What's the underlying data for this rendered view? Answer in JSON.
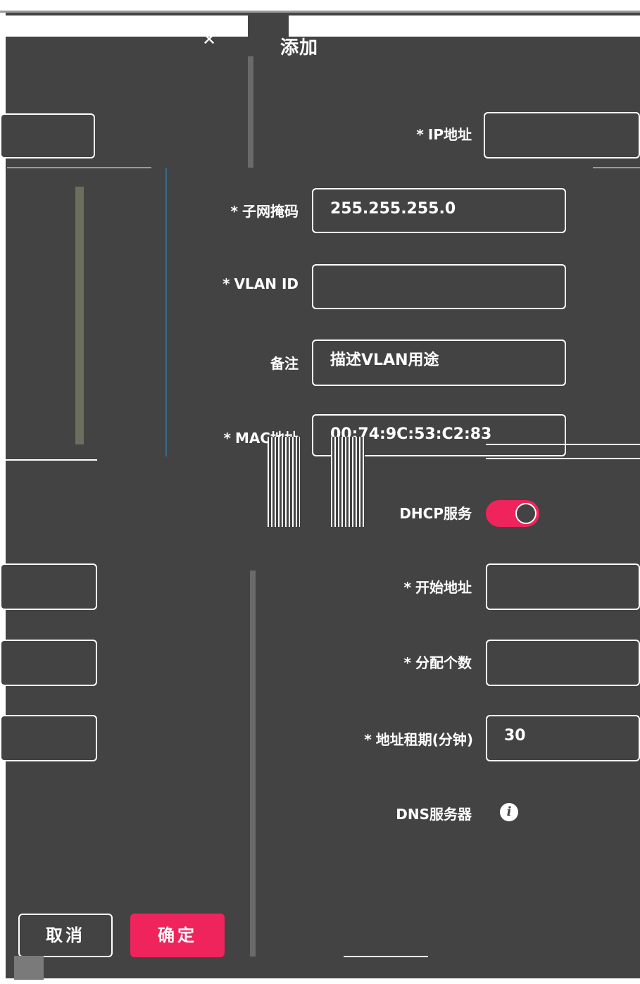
{
  "dialog": {
    "title": "添加",
    "close_glyph": "✕"
  },
  "fields": {
    "ip_address": {
      "label": "IP地址",
      "required_mark": "*",
      "value": ""
    },
    "subnet_mask": {
      "label": "子网掩码",
      "required_mark": "*",
      "value": "255.255.255.0"
    },
    "vlan_id": {
      "label": "VLAN ID",
      "required_mark": "*",
      "value": ""
    },
    "remark": {
      "label": "备注",
      "value": "描述VLAN用途"
    },
    "mac_address": {
      "label": "MAC地址",
      "required_mark": "*",
      "value": "00:74:9C:53:C2:83"
    },
    "dhcp_service": {
      "label": "DHCP服务",
      "enabled": true
    },
    "start_address": {
      "label": "开始地址",
      "required_mark": "*",
      "value": ""
    },
    "alloc_count": {
      "label": "分配个数",
      "required_mark": "*",
      "value": ""
    },
    "lease_time": {
      "label": "地址租期(分钟)",
      "required_mark": "*",
      "value": "30"
    },
    "dns_server": {
      "label": "DNS服务器",
      "info_glyph": "i"
    }
  },
  "buttons": {
    "cancel": "取消",
    "confirm": "确定"
  },
  "colors": {
    "background": "#434343",
    "accent": "#f0245c",
    "text": "#ffffff"
  },
  "icons": [
    "close-icon",
    "info-icon"
  ]
}
